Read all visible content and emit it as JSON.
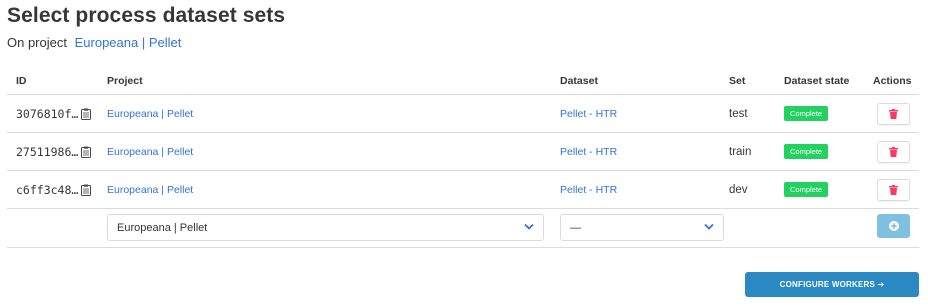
{
  "page": {
    "title": "Select process dataset sets",
    "subtitle_prefix": "On project",
    "project_link": "Europeana | Pellet"
  },
  "table": {
    "headers": {
      "id": "ID",
      "project": "Project",
      "dataset": "Dataset",
      "set": "Set",
      "state": "Dataset state",
      "actions": "Actions"
    },
    "rows": [
      {
        "id": "3076810f…",
        "project": "Europeana | Pellet",
        "dataset": "Pellet - HTR",
        "set": "test",
        "state": "Complete"
      },
      {
        "id": "27511986…",
        "project": "Europeana | Pellet",
        "dataset": "Pellet - HTR",
        "set": "train",
        "state": "Complete"
      },
      {
        "id": "c6ff3c48…",
        "project": "Europeana | Pellet",
        "dataset": "Pellet - HTR",
        "set": "dev",
        "state": "Complete"
      }
    ]
  },
  "new_row": {
    "project_select": "Europeana | Pellet",
    "dataset_select": "—"
  },
  "footer": {
    "configure_label": "CONFIGURE WORKERS ➔"
  },
  "colors": {
    "link": "#3273dc",
    "badge_complete": "#23d160",
    "delete_icon": "#ff3860",
    "add_button": "#7fc0e0",
    "primary": "#2a88c2"
  },
  "icons": {
    "copy": "clipboard-icon",
    "delete": "trash-icon",
    "add": "plus-circle-icon",
    "dropdown": "chevron-down-icon"
  }
}
